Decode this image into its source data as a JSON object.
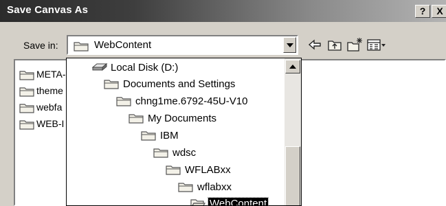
{
  "window": {
    "title": "Save Canvas As",
    "help_label": "?",
    "close_label": "X"
  },
  "toolbar": {
    "save_in_label": "Save in:",
    "save_in_value": "WebContent",
    "tools": [
      "back-arrow-icon",
      "up-folder-icon",
      "new-folder-icon",
      "view-menu-icon"
    ]
  },
  "file_list": {
    "items": [
      {
        "label": "META-"
      },
      {
        "label": "theme"
      },
      {
        "label": "webfa"
      },
      {
        "label": "WEB-I"
      }
    ]
  },
  "dropdown": {
    "items": [
      {
        "label": "Local Disk (D:)",
        "icon": "disk-drive-icon",
        "level": 0
      },
      {
        "label": "Documents and Settings",
        "icon": "folder-icon",
        "level": 1
      },
      {
        "label": "chng1me.6792-45U-V10",
        "icon": "folder-icon",
        "level": 2
      },
      {
        "label": "My Documents",
        "icon": "folder-icon",
        "level": 3
      },
      {
        "label": "IBM",
        "icon": "folder-icon",
        "level": 4
      },
      {
        "label": "wdsc",
        "icon": "folder-icon",
        "level": 5
      },
      {
        "label": "WFLABxx",
        "icon": "folder-icon",
        "level": 6
      },
      {
        "label": "wflabxx",
        "icon": "folder-icon",
        "level": 7
      },
      {
        "label": "WebContent",
        "icon": "open-folder-icon",
        "level": 8,
        "selected": true
      }
    ]
  },
  "colors": {
    "selection": "#000000",
    "dialog_face": "#d4d0c8",
    "title_dark": "#2b2b2b"
  }
}
